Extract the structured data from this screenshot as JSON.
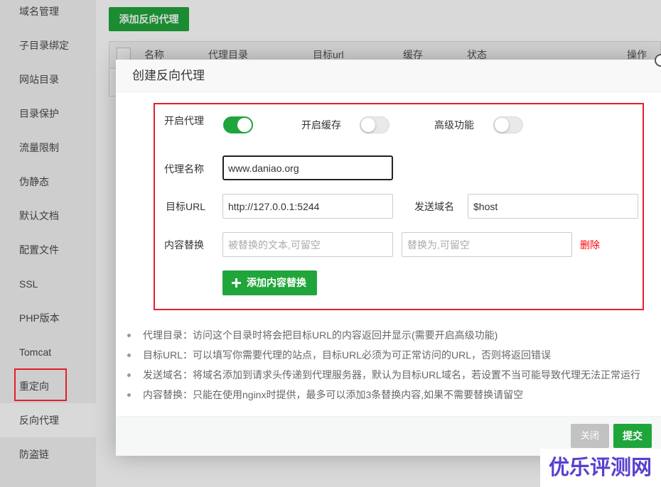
{
  "sidebar": {
    "items": [
      "域名管理",
      "子目录绑定",
      "网站目录",
      "目录保护",
      "流量限制",
      "伪静态",
      "默认文档",
      "配置文件",
      "SSL",
      "PHP版本",
      "Tomcat",
      "重定向",
      "反向代理",
      "防盗链"
    ],
    "active_index": 12
  },
  "toolbar": {
    "add_proxy_label": "添加反向代理"
  },
  "proxy_table": {
    "columns": [
      "名称",
      "代理目录",
      "目标url",
      "缓存",
      "状态",
      "操作"
    ]
  },
  "dialog": {
    "title": "创建反向代理",
    "form": {
      "enable_proxy": {
        "label": "开启代理",
        "on": true
      },
      "enable_cache": {
        "label": "开启缓存",
        "on": false
      },
      "advanced": {
        "label": "高级功能",
        "on": false
      },
      "proxy_name": {
        "label": "代理名称",
        "value": "www.daniao.org",
        "focused": true
      },
      "target_url": {
        "label": "目标URL",
        "value": "http://127.0.0.1:5244"
      },
      "send_domain": {
        "label": "发送域名",
        "value": "$host"
      },
      "content_replace": {
        "label": "内容替换",
        "from_placeholder": "被替换的文本,可留空",
        "to_placeholder": "替换为,可留空",
        "delete_label": "删除"
      },
      "add_replace_label": "添加内容替换"
    },
    "notes": [
      "代理目录：访问这个目录时将会把目标URL的内容返回并显示(需要开启高级功能)",
      "目标URL：可以填写你需要代理的站点，目标URL必须为可正常访问的URL，否则将返回错误",
      "发送域名：将域名添加到请求头传递到代理服务器，默认为目标URL域名，若设置不当可能导致代理无法正常运行",
      "内容替换：只能在使用nginx时提供，最多可以添加3条替换内容,如果不需要替换请留空"
    ],
    "footer": {
      "close_label": "关闭",
      "submit_label": "提交"
    }
  },
  "watermark": {
    "text": "优乐评测网"
  },
  "icons": {
    "dialog_close": "close-icon",
    "add": "plus-icon",
    "bullet": "bullet-icon"
  },
  "colors": {
    "accent": "#20a53a",
    "danger": "#ff0000",
    "annotation": "#e0202a",
    "watermark": "#5a3fcf",
    "close_button": "#c2c2c2"
  }
}
